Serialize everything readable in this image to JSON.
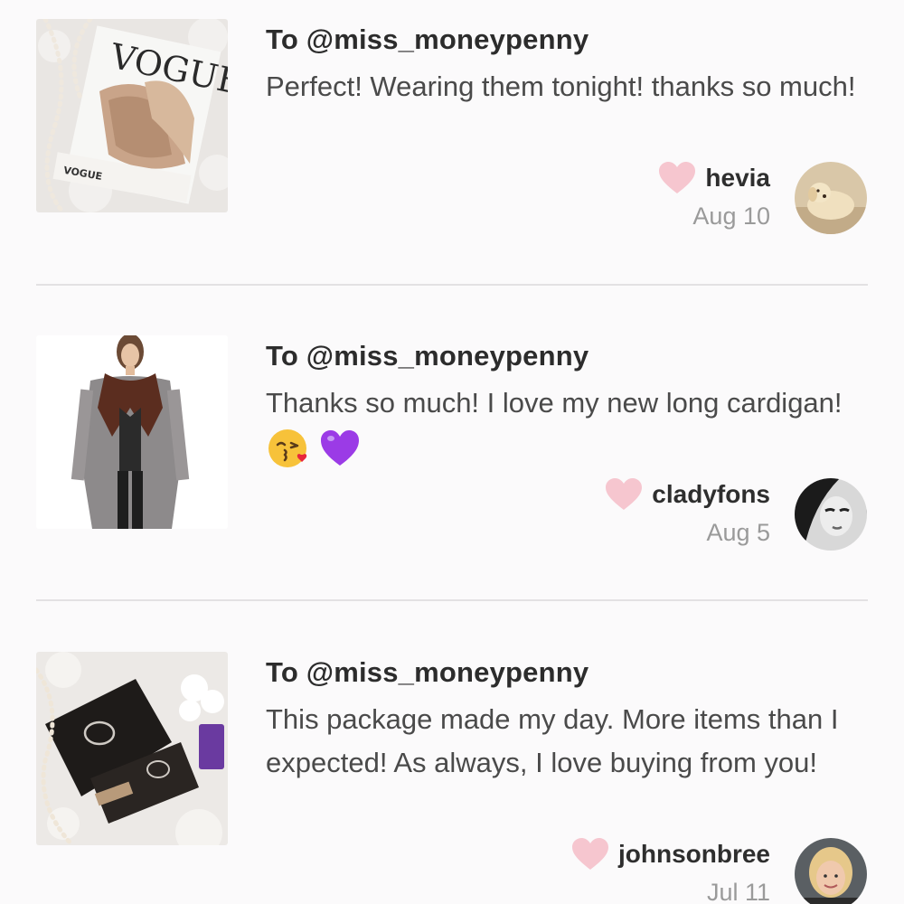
{
  "colors": {
    "background": "#fbfafb",
    "heart": "#f6c6cf",
    "divider": "#e3e1e3",
    "date": "#9a9a9a"
  },
  "reviews": [
    {
      "to": "To @miss_moneypenny",
      "message": "Perfect! Wearing them tonight! thanks so much!",
      "emojis": [],
      "username": "hevia",
      "date": "Aug 10",
      "image": "vogue-shoes-photo",
      "avatar": "dog-avatar"
    },
    {
      "to": "To @miss_moneypenny",
      "message": "Thanks so much! I love my new long cardigan!",
      "emojis": [
        "kissing-face-emoji",
        "purple-heart-emoji"
      ],
      "username": "cladyfons",
      "date": "Aug 5",
      "image": "cardigan-model-photo",
      "avatar": "bw-portrait-avatar"
    },
    {
      "to": "To @miss_moneypenny",
      "message": "This package made my day. More items than I expected! As always, I love buying from you!",
      "emojis": [],
      "username": "johnsonbree",
      "date": "Jul 11",
      "image": "cosmetics-package-photo",
      "avatar": "woman-avatar"
    }
  ]
}
